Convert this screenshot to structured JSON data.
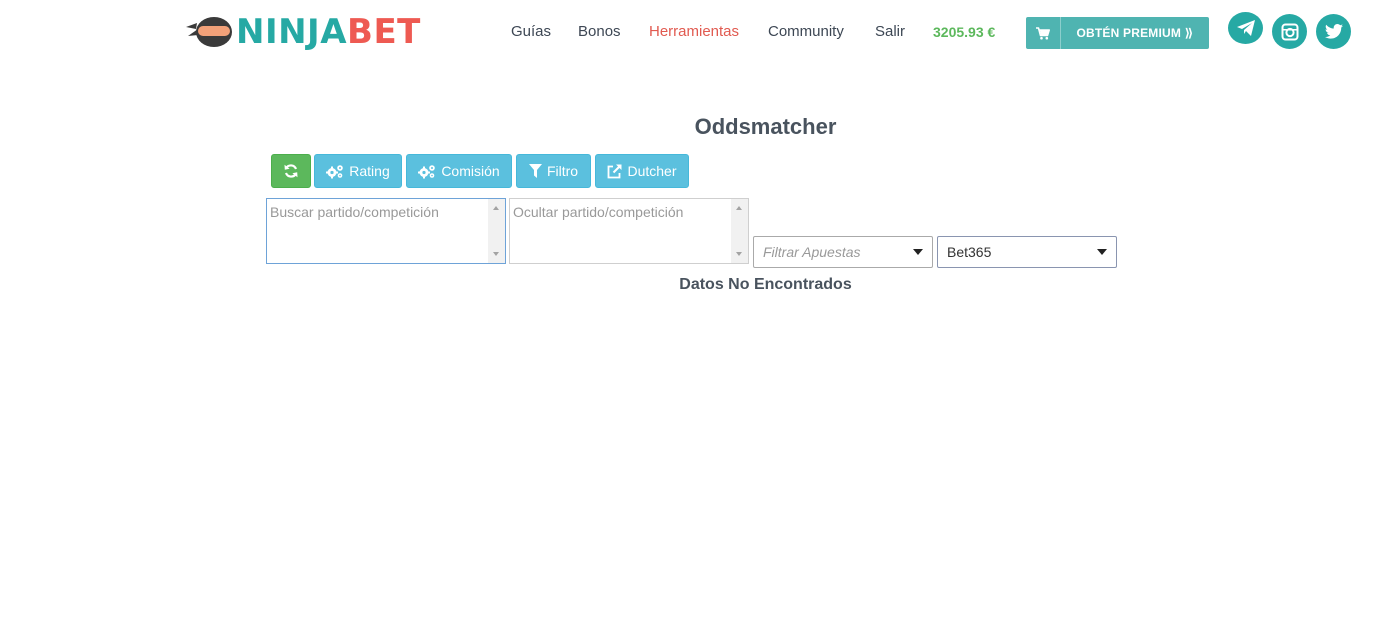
{
  "header": {
    "logo": {
      "part1": "NINJA",
      "part2": "BET",
      "colors": {
        "ninja": "#26a9a4",
        "bet": "#ee5a52"
      }
    },
    "nav": [
      {
        "label": "Guías",
        "active": false
      },
      {
        "label": "Bonos",
        "active": false
      },
      {
        "label": "Herramientas",
        "active": true
      },
      {
        "label": "Community",
        "active": false
      },
      {
        "label": "Salir",
        "active": false
      }
    ],
    "balance": "3205.93 €",
    "premium": {
      "label": "OBTÉN PREMIUM ⟫",
      "icon": "cart-icon"
    },
    "social": [
      {
        "icon": "telegram-icon"
      },
      {
        "icon": "instagram-icon"
      },
      {
        "icon": "twitter-icon"
      }
    ]
  },
  "main": {
    "title": "Oddsmatcher",
    "toolbar": {
      "refresh": {
        "icon": "refresh-icon"
      },
      "rating": {
        "label": "Rating",
        "icon": "cogs-icon"
      },
      "comision": {
        "label": "Comisión",
        "icon": "cogs-icon"
      },
      "filtro": {
        "label": "Filtro",
        "icon": "filter-icon"
      },
      "dutcher": {
        "label": "Dutcher",
        "icon": "external-link-icon"
      }
    },
    "search": {
      "placeholder": "Buscar partido/competición",
      "value": ""
    },
    "hide": {
      "placeholder": "Ocultar partido/competición",
      "value": ""
    },
    "bet_filter": {
      "placeholder": "Filtrar Apuestas"
    },
    "bookmaker": {
      "value": "Bet365"
    },
    "empty_message": "Datos No Encontrados"
  },
  "colors": {
    "teal": "#26a9a4",
    "premium": "#4fb4b1",
    "active_nav": "#e15a50",
    "balance": "#5cb85c",
    "info_button": "#5bc0de",
    "success_button": "#5cb85c"
  }
}
